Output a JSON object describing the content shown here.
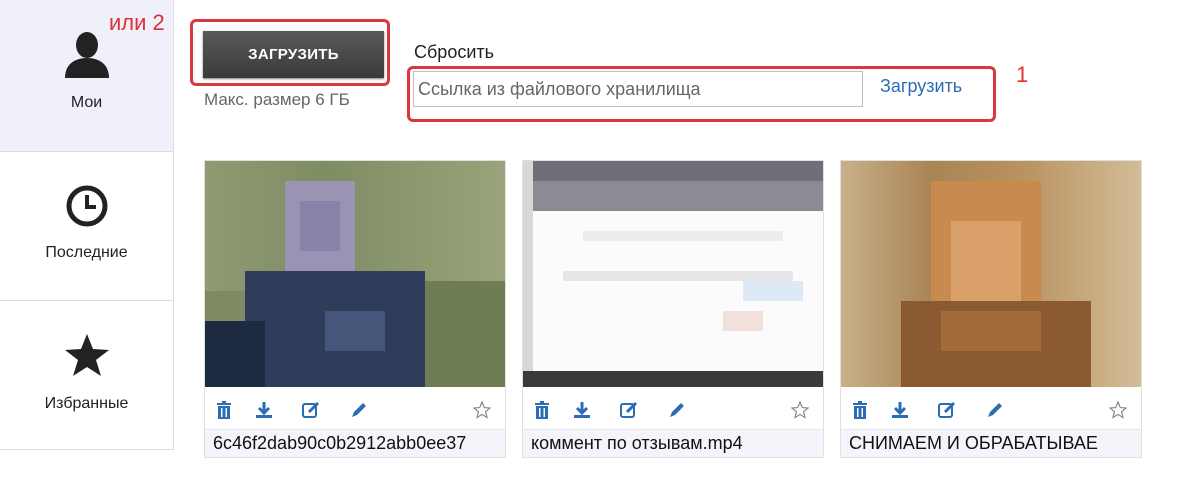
{
  "sidebar": {
    "items": [
      {
        "label": "Мои",
        "icon": "user-icon"
      },
      {
        "label": "Последние",
        "icon": "clock-icon"
      },
      {
        "label": "Избранные",
        "icon": "star-icon"
      }
    ]
  },
  "annotations": {
    "label_2": "или 2",
    "label_1": "1"
  },
  "upload": {
    "button_label": "ЗАГРУЗИТЬ",
    "max_size": "Макс. размер 6 ГБ",
    "reset_label": "Сбросить",
    "url_placeholder": "Ссылка из файлового хранилища",
    "url_upload_label": "Загрузить"
  },
  "files": [
    {
      "name": "6c46f2dab90c0b2912abb0ee37"
    },
    {
      "name": "коммент по отзывам.mp4"
    },
    {
      "name": "СНИМАЕМ И ОБРАБАТЫВАЕ"
    }
  ],
  "colors": {
    "accent_link": "#2a6db5",
    "annotation_red": "#d9393e",
    "tool_icon_blue": "#2a6db5",
    "sidebar_active_bg": "#f0f0fb"
  }
}
